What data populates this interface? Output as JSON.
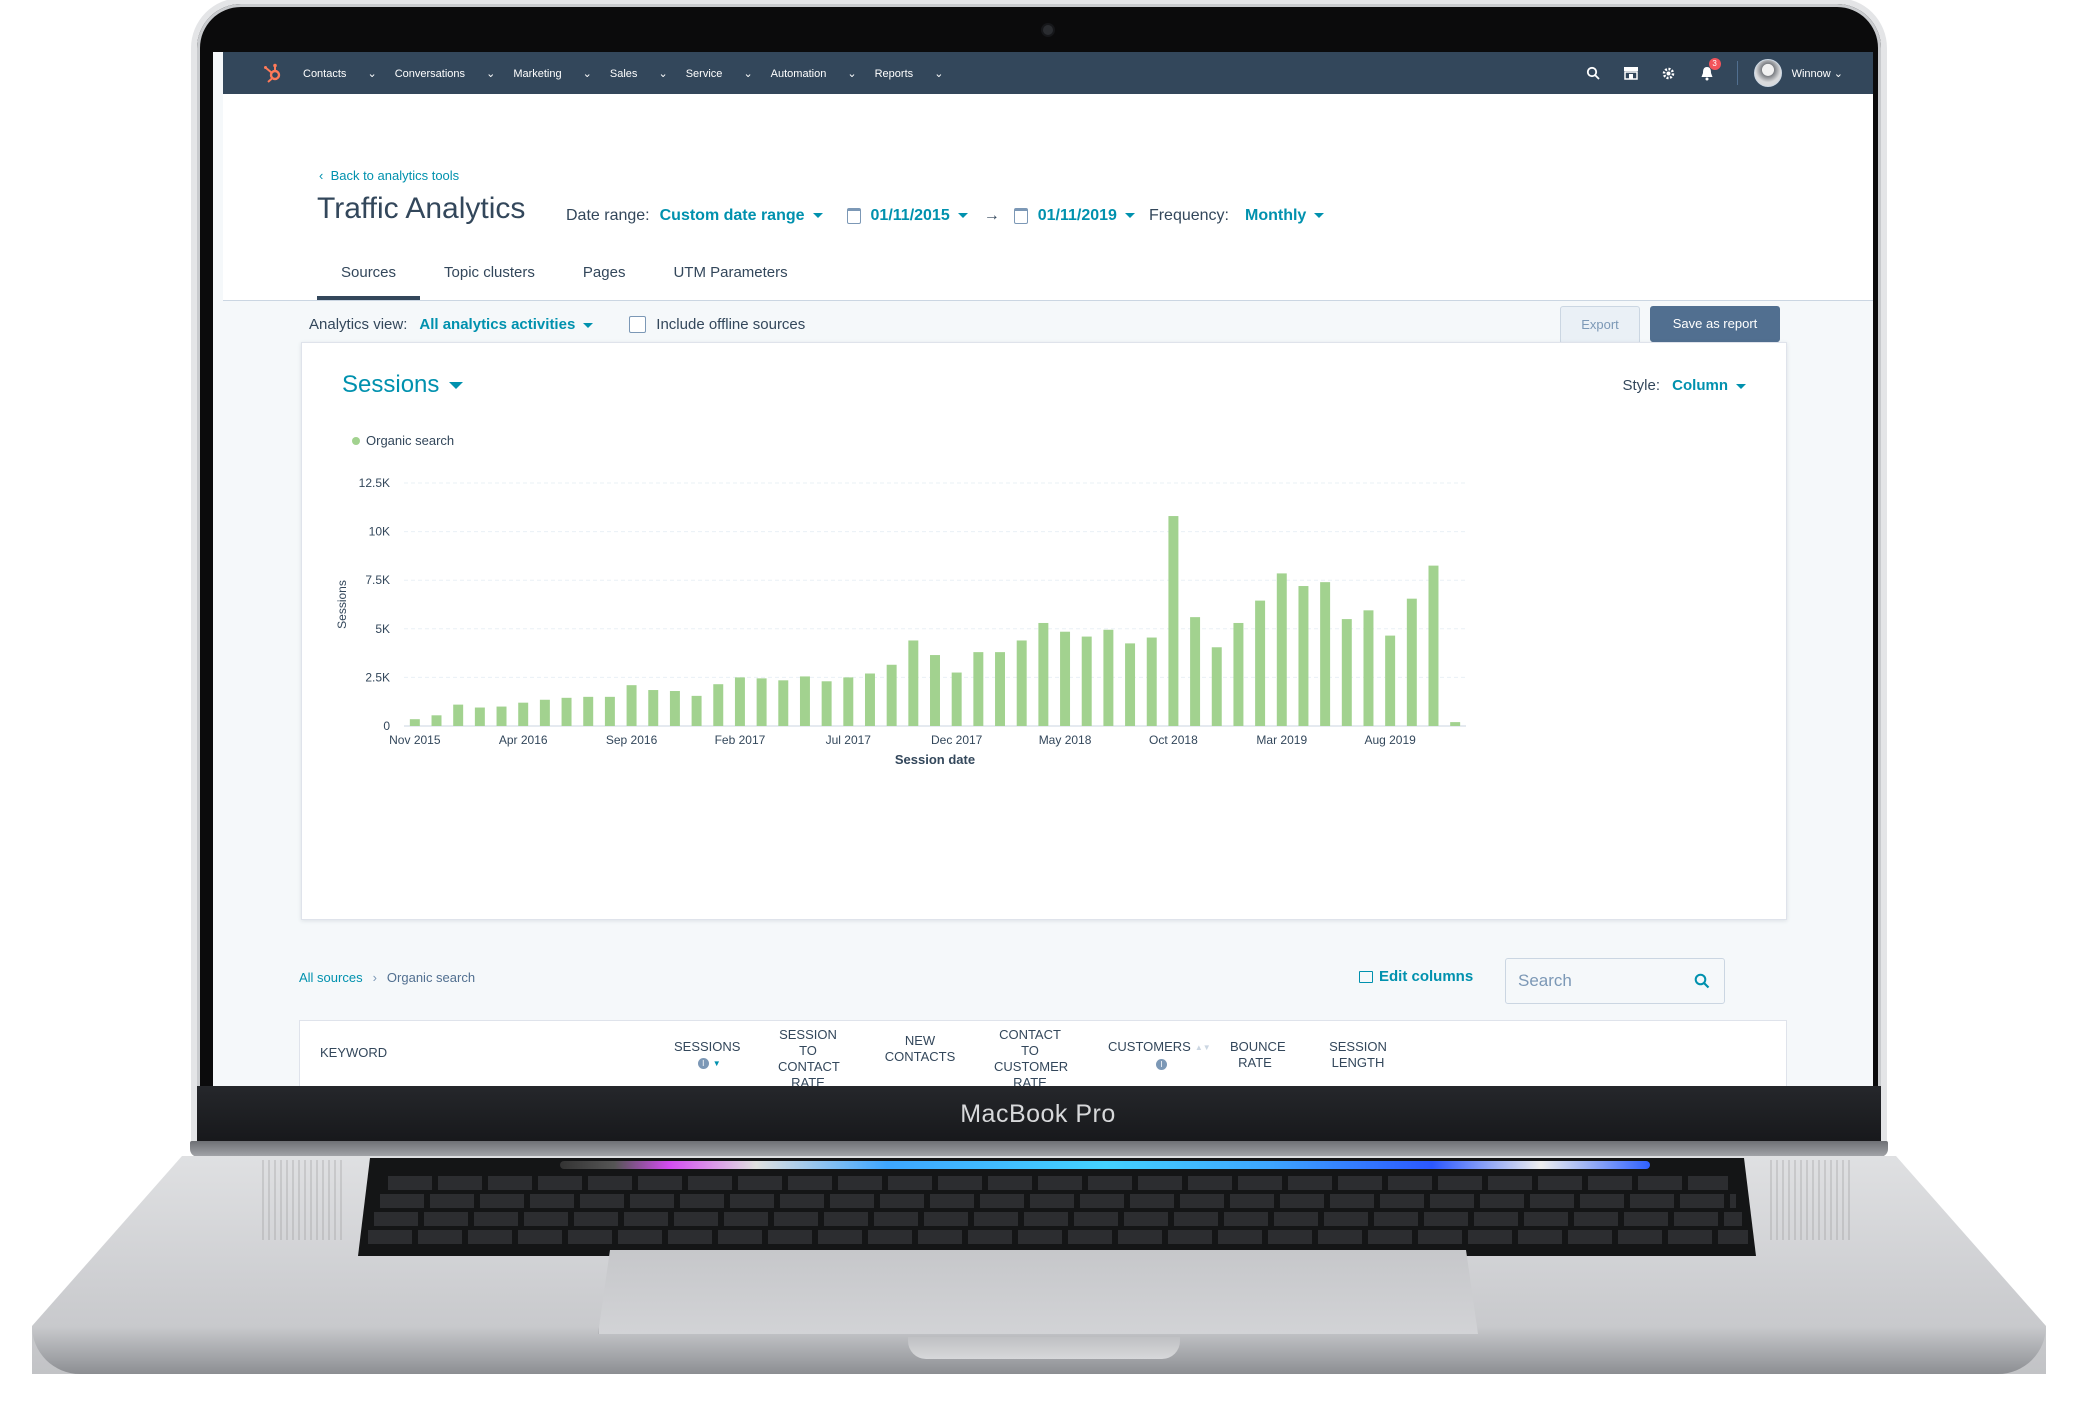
{
  "device": {
    "label": "MacBook Pro"
  },
  "nav": {
    "menu": [
      "Contacts",
      "Conversations",
      "Marketing",
      "Sales",
      "Service",
      "Automation",
      "Reports"
    ],
    "notification_count": "3",
    "user": "Winnow"
  },
  "header": {
    "back_link": "Back to analytics tools",
    "title": "Traffic Analytics",
    "date_range_label": "Date range:",
    "date_range_value": "Custom date range",
    "start_date": "01/11/2015",
    "end_date": "01/11/2019",
    "frequency_label": "Frequency:",
    "frequency_value": "Monthly"
  },
  "tabs": [
    "Sources",
    "Topic clusters",
    "Pages",
    "UTM Parameters"
  ],
  "active_tab": "Sources",
  "toolbar": {
    "view_label": "Analytics view:",
    "view_value": "All analytics activities",
    "offline_label": "Include offline sources",
    "export_label": "Export",
    "save_label": "Save as report"
  },
  "chart_card": {
    "metric": "Sessions",
    "style_label": "Style:",
    "style_value": "Column"
  },
  "chart_data": {
    "type": "bar",
    "series": [
      {
        "name": "Organic search",
        "color": "#a2d28f",
        "values": [
          350,
          550,
          1100,
          950,
          1000,
          1200,
          1350,
          1450,
          1500,
          1500,
          2100,
          1850,
          1800,
          1550,
          2150,
          2500,
          2450,
          2350,
          2550,
          2300,
          2500,
          2700,
          3150,
          4400,
          3650,
          2750,
          3800,
          3800,
          4400,
          5300,
          4850,
          4600,
          4950,
          4250,
          4550,
          10800,
          5600,
          4050,
          5300,
          6450,
          7850,
          7200,
          7400,
          5500,
          5950,
          4650,
          6550,
          8250,
          200
        ]
      }
    ],
    "x_tick_labels": [
      "Nov 2015",
      "Apr 2016",
      "Sep 2016",
      "Feb 2017",
      "Jul 2017",
      "Dec 2017",
      "May 2018",
      "Oct 2018",
      "Mar 2019",
      "Aug 2019"
    ],
    "y_tick_labels": [
      "0",
      "2.5K",
      "5K",
      "7.5K",
      "10K",
      "12.5K"
    ],
    "ylim": [
      0,
      12500
    ],
    "xlabel": "Session date",
    "ylabel": "Sessions",
    "grid": true,
    "legend": "top-left"
  },
  "breadcrumb": {
    "root": "All sources",
    "current": "Organic search"
  },
  "table_tools": {
    "edit_columns": "Edit columns",
    "search_placeholder": "Search"
  },
  "table": {
    "columns": [
      "KEYWORD",
      "SESSIONS",
      "SESSION TO CONTACT RATE",
      "NEW CONTACTS",
      "CONTACT TO CUSTOMER RATE",
      "CUSTOMERS",
      "BOUNCE RATE",
      "SESSION LENGTH"
    ]
  }
}
